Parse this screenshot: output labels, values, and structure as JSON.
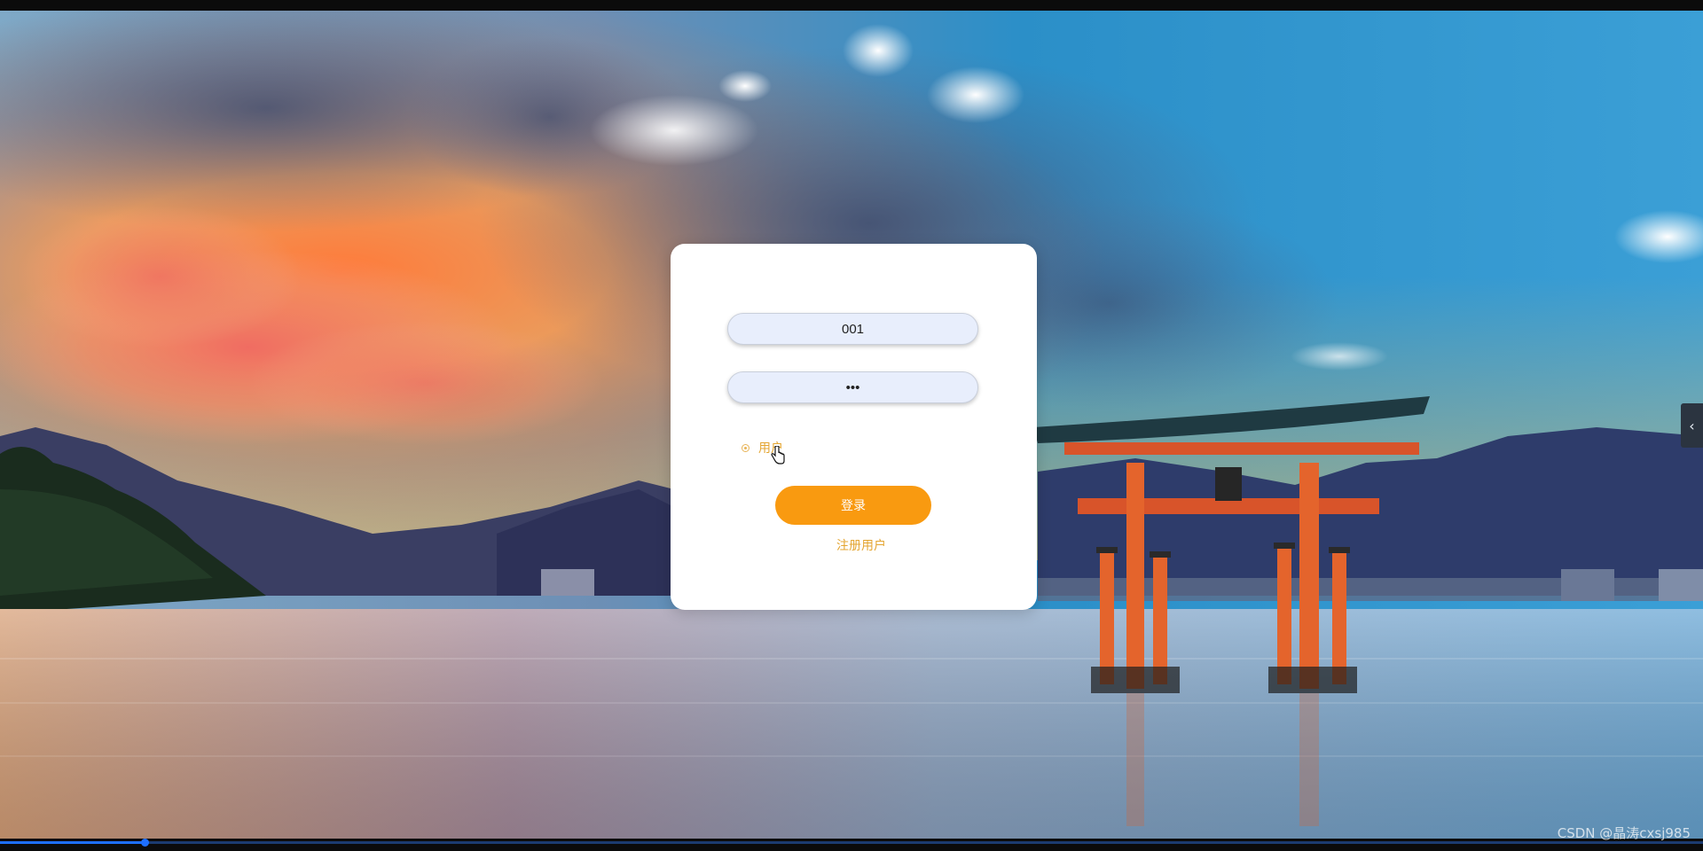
{
  "login": {
    "username_value": "001",
    "password_value": "pwd",
    "role_option_label": "用户",
    "login_button_label": "登录",
    "register_link_label": "注册用户"
  },
  "side_toggle": {
    "icon": "chevron-left-icon",
    "glyph": "‹"
  },
  "watermark": {
    "text": "CSDN @晶涛cxsj985"
  },
  "colors": {
    "accent": "#f99a10",
    "link": "#e4a531",
    "input_bg": "#e8eefc",
    "card_bg": "#ffffff"
  },
  "page_progress": {
    "fraction": 0.085
  }
}
